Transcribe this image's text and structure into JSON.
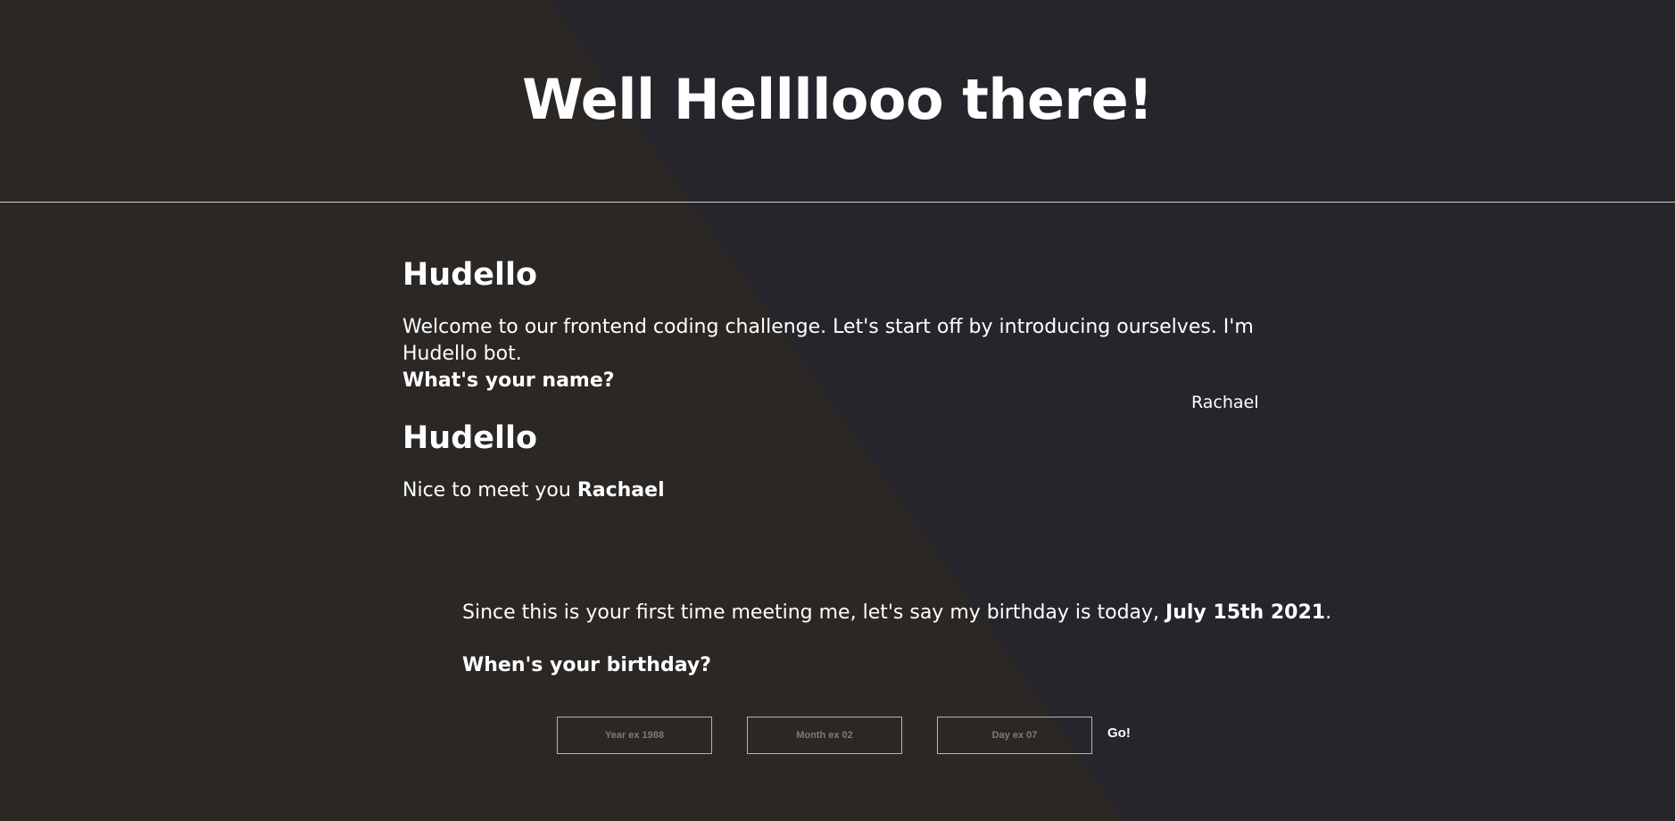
{
  "header": {
    "title": "Well Hellllooo there!"
  },
  "chat": {
    "bot_name": "Hudello",
    "intro": {
      "text": "Welcome to our frontend coding challenge. Let's start off by introducing ourselves. I'm Hudello bot.",
      "question": "What's your name?"
    },
    "user_reply": "Rachael",
    "greeting": {
      "prefix": "Nice to meet you ",
      "name": "Rachael"
    },
    "birthday": {
      "text_prefix": "Since this is your first time meeting me, let's say my birthday is today, ",
      "date": "July 15th 2021",
      "text_suffix": ".",
      "question": "When's your birthday?"
    }
  },
  "form": {
    "year_placeholder": "Year ex 1988",
    "month_placeholder": "Month ex 02",
    "day_placeholder": "Day ex 07",
    "submit_label": "Go!"
  },
  "colors": {
    "background_left": "#2a2725",
    "background_right": "#25252b",
    "text": "#ffffff",
    "input_border": "#b5b3c4",
    "placeholder": "#7d7b7b"
  }
}
